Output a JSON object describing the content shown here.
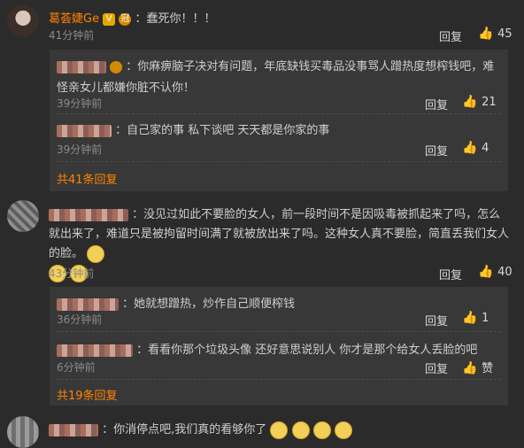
{
  "comments": [
    {
      "username": "葛荟婕Ge",
      "badges": [
        "V",
        "冠"
      ],
      "text": "：蠢死你！！！",
      "time": "41分钟前",
      "reply_label": "回复",
      "like_count": "45",
      "replies": [
        {
          "text": "：你麻痹脑子决对有问题，年底缺钱买毒品没事骂人蹭热度想榨钱吧，难怪亲女儿都嫌你脏不认你！",
          "time": "39分钟前",
          "reply_label": "回复",
          "like_count": "21"
        },
        {
          "text": "：自己家的事 私下谈吧 天天都是你家的事",
          "time": "39分钟前",
          "reply_label": "回复",
          "like_count": "4"
        }
      ],
      "replies_total": "共41条回复"
    },
    {
      "text": "：没见过如此不要脸的女人，前一段时间不是因吸毒被抓起来了吗，怎么就出来了，难道只是被拘留时间满了就被放出来了吗。这种女人真不要脸，简直丢我们女人的脸。",
      "time": "43分钟前",
      "reply_label": "回复",
      "like_count": "40",
      "replies": [
        {
          "text": "：她就想蹭热，炒作自己顺便榨钱",
          "time": "36分钟前",
          "reply_label": "回复",
          "like_count": "1"
        },
        {
          "text": "：看看你那个垃圾头像 还好意思说别人 你才是那个给女人丢脸的吧",
          "time": "6分钟前",
          "reply_label": "回复",
          "like_count": "赞"
        }
      ],
      "replies_total": "共19条回复"
    },
    {
      "text": "：你消停点吧,我们真的看够你了"
    }
  ],
  "icons": {
    "like": "thumb-up-icon",
    "emoji": "laughing-emoji-icon"
  }
}
